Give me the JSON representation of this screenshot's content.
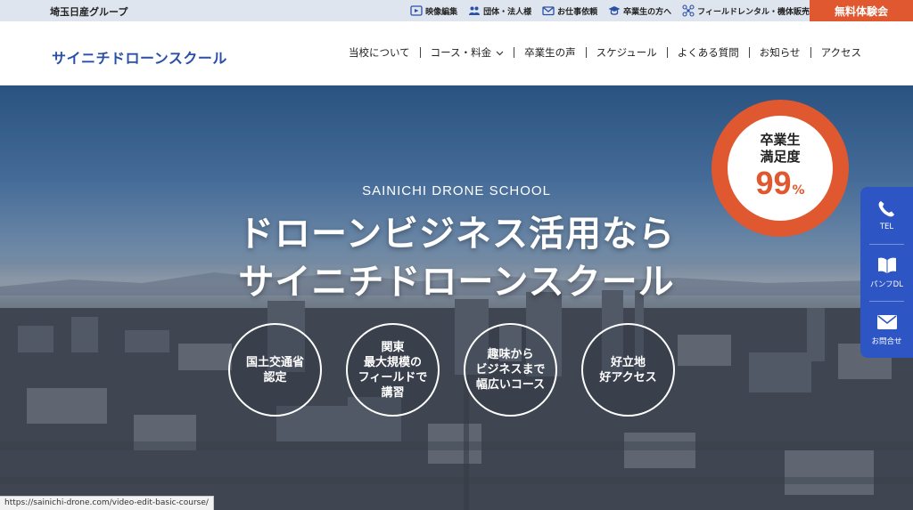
{
  "topbar": {
    "group_name": "埼玉日産グループ",
    "links": [
      {
        "label": "映像編集",
        "icon": "video-edit-icon"
      },
      {
        "label": "団体・法人様",
        "icon": "group-icon"
      },
      {
        "label": "お仕事依頼",
        "icon": "mail-icon"
      },
      {
        "label": "卒業生の方へ",
        "icon": "graduation-cap-icon"
      },
      {
        "label": "フィールドレンタル・機体販売",
        "icon": "drone-icon"
      }
    ],
    "cta": "無料体験会"
  },
  "header": {
    "logo": "サイニチドローンスクール",
    "nav": [
      {
        "label": "当校について"
      },
      {
        "label": "コース・料金"
      },
      {
        "label": "卒業生の声"
      },
      {
        "label": "スケジュール"
      },
      {
        "label": "よくある質問"
      },
      {
        "label": "お知らせ"
      },
      {
        "label": "アクセス"
      }
    ]
  },
  "hero": {
    "school_name_en": "SAINICHI DRONE SCHOOL",
    "headline_line1": "ドローンビジネス活用なら",
    "headline_line2": "サイニチドローンスクール",
    "features": [
      "国土交通省\n認定",
      "関東\n最大規模の\nフィールドで\n講習",
      "趣味から\nビジネスまで\n幅広いコース",
      "好立地\n好アクセス"
    ],
    "badge": {
      "label": "卒業生\n満足度",
      "value": "99",
      "unit": "%"
    }
  },
  "side_buttons": [
    {
      "label": "TEL",
      "icon": "phone-icon"
    },
    {
      "label": "パンフDL",
      "icon": "book-icon"
    },
    {
      "label": "お問合せ",
      "icon": "envelope-icon"
    }
  ],
  "status_bar": {
    "url": "https://sainichi-drone.com/video-edit-basic-course/"
  },
  "colors": {
    "accent": "#e0582f",
    "brand_blue": "#2a4fa6",
    "side_blue": "#2e55c4",
    "topbar_bg": "#dfe5ee"
  }
}
